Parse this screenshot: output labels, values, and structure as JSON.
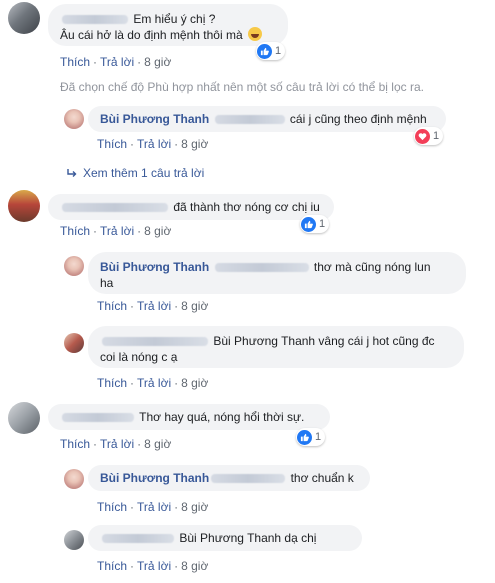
{
  "actions": {
    "like": "Thích",
    "reply": "Trả lời",
    "sep": "·",
    "time": "8 giờ"
  },
  "author": "Bùi Phương Thanh",
  "comments": [
    {
      "line1": "Em hiểu ý chị ?",
      "line2": "Âu cái hở là do định mệnh thôi mà",
      "reaction_count": "1"
    },
    {
      "text": "đã thành thơ nóng cơ chị iu",
      "reaction_count": "1"
    },
    {
      "text": "Thơ hay quá, nóng hổi thời sự.",
      "reaction_count": "1"
    }
  ],
  "filter_notice": "Đã chọn chế độ Phù hợp nhất nên một số câu trả lời có thể bị lọc ra.",
  "replies": [
    {
      "text": "cái j cũng theo định mệnh",
      "reaction_count": "1"
    },
    {
      "text_a": "thơ mà cũng nóng lun",
      "text_b": "ha"
    },
    {
      "text_a": "Bùi Phương Thanh vâng cái j hot cũng đc",
      "text_b": "coi là nóng c ạ"
    },
    {
      "text": "thơ chuẩn k"
    },
    {
      "text": "Bùi Phương Thanh dạ chị"
    }
  ],
  "view_more": "Xem thêm 1 câu trả lời",
  "icons": {
    "like": "thumbs-up-icon",
    "heart": "heart-icon",
    "emoji": "laughing-emoji-icon",
    "arrow": "reply-arrow-icon"
  }
}
